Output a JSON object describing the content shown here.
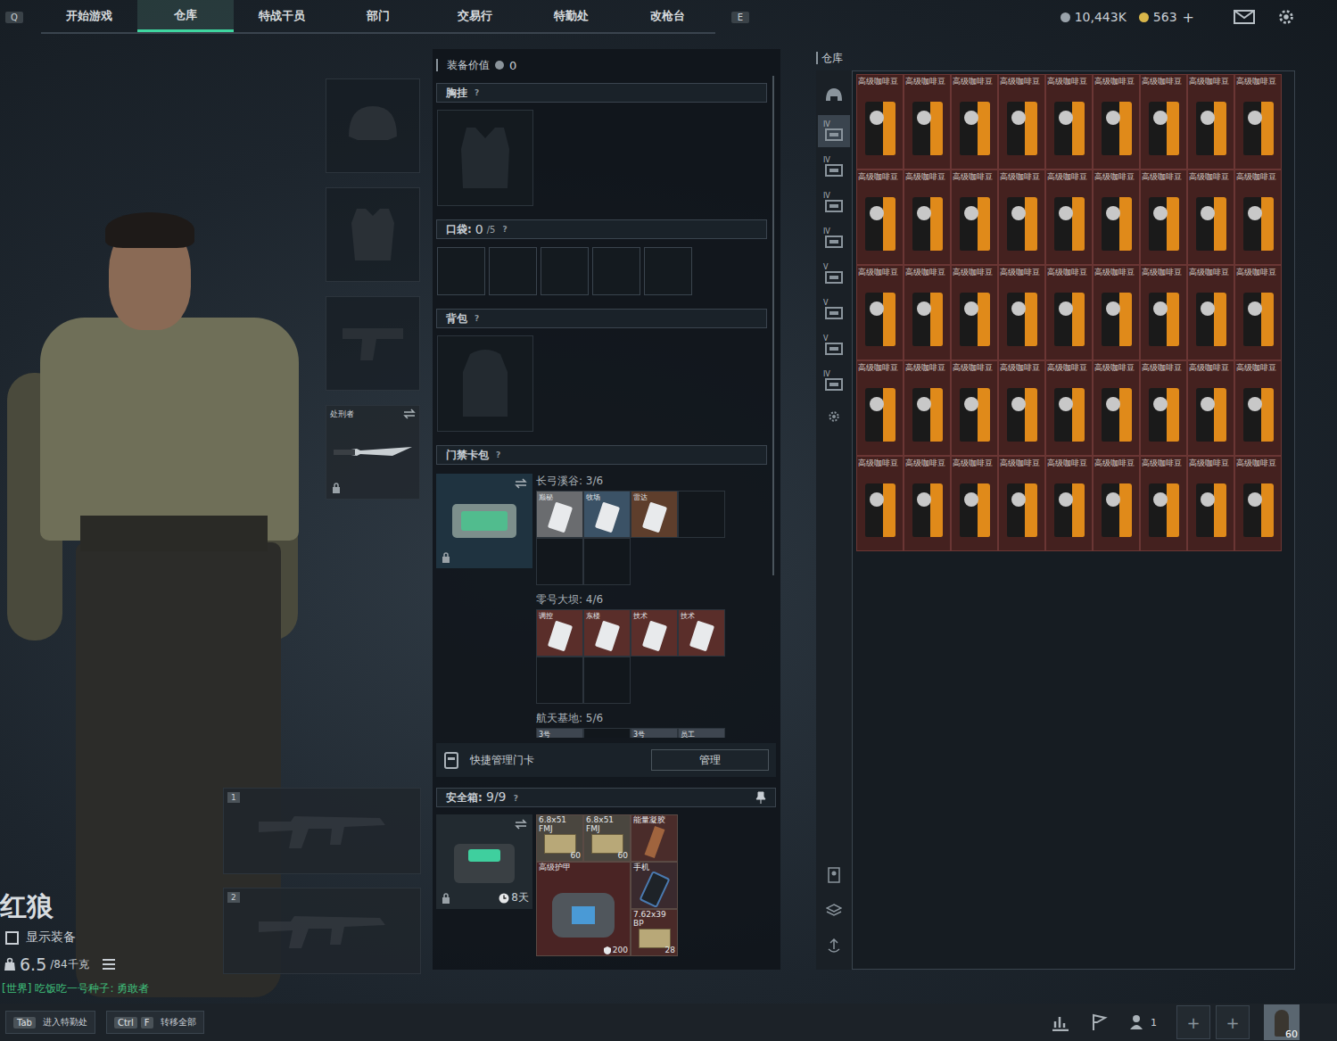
{
  "nav": {
    "left_key": "Q",
    "tabs": [
      {
        "label": "开始游戏",
        "selected": false
      },
      {
        "label": "仓库",
        "selected": true
      },
      {
        "label": "特战干员",
        "selected": false
      },
      {
        "label": "部门",
        "selected": false
      },
      {
        "label": "交易行",
        "selected": false
      },
      {
        "label": "特勤处",
        "selected": false
      },
      {
        "label": "改枪台",
        "selected": false
      }
    ],
    "right_key": "E",
    "currencies": [
      {
        "value": "10,443K",
        "color": "#9aa3ab"
      },
      {
        "value": "563",
        "color": "#d9b64a"
      }
    ],
    "add": "+"
  },
  "character": {
    "name": "红狼",
    "show_equipment": {
      "label": "显示装备",
      "checked": false
    },
    "weight": "6.5",
    "weight_max": "/84千克"
  },
  "chat": {
    "channel": "[世界]",
    "text": "吃饭吃一号种子: 勇敢者"
  },
  "gear_slots": [
    {
      "kind": "helmet",
      "filled": false
    },
    {
      "kind": "armor",
      "filled": false
    },
    {
      "kind": "pistol",
      "filled": false
    },
    {
      "kind": "melee",
      "filled": true,
      "label": "处刑者",
      "locked": true
    }
  ],
  "weapon_slots": [
    {
      "number": "1",
      "filled": false
    },
    {
      "number": "2",
      "filled": false
    }
  ],
  "loadout": {
    "value_label": "装备价值",
    "value": "0",
    "chest_rig": {
      "label": "胸挂",
      "help": "?"
    },
    "pockets": {
      "label": "口袋:",
      "count": "0",
      "capacity": "/5",
      "help": "?",
      "slots": [
        {
          "filled": false
        },
        {
          "filled": false
        },
        {
          "filled": false
        },
        {
          "filled": false
        },
        {
          "filled": false
        }
      ]
    },
    "backpack": {
      "label": "背包",
      "help": "?"
    },
    "keycard_case": {
      "label": "门禁卡包",
      "help": "?",
      "locked": true,
      "regions": [
        {
          "name": "长弓溪谷: 3/6",
          "cards": [
            {
              "filled": true,
              "label": "巅秘",
              "color": "#6a6c6f"
            },
            {
              "filled": true,
              "label": "牧场",
              "color": "#3b5266"
            },
            {
              "filled": true,
              "label": "雷达",
              "color": "#5e3e2c"
            },
            {
              "filled": false
            },
            {
              "filled": false
            },
            {
              "filled": false
            }
          ]
        },
        {
          "name": "零号大坝: 4/6",
          "cards": [
            {
              "filled": true,
              "label": "调控",
              "color": "#5a2e2a"
            },
            {
              "filled": true,
              "label": "东楼",
              "color": "#5a2e2a"
            },
            {
              "filled": true,
              "label": "技术",
              "color": "#5a2e2a"
            },
            {
              "filled": true,
              "label": "技术",
              "color": "#5a2e2a"
            },
            {
              "filled": false
            },
            {
              "filled": false
            }
          ]
        },
        {
          "name": "航天基地: 5/6",
          "cards": [
            {
              "filled": true,
              "label": "3号",
              "color": "#3e4650"
            },
            {
              "filled": false
            },
            {
              "filled": true,
              "label": "3号",
              "color": "#3e4650"
            },
            {
              "filled": true,
              "label": "员工",
              "color": "#3e4650"
            }
          ]
        }
      ]
    },
    "quick_manage": {
      "label": "快捷管理门卡",
      "button": "管理"
    },
    "safe_box": {
      "label": "安全箱:",
      "count": "9/9",
      "help": "?",
      "timer": "8天",
      "locked": true,
      "items": [
        {
          "kind": "ammo",
          "label": "6.8x51 FMJ",
          "count": "60",
          "color": "#4a463f"
        },
        {
          "kind": "ammo",
          "label": "6.8x51 FMJ",
          "count": "60",
          "color": "#4a463f"
        },
        {
          "kind": "gel",
          "label": "能量凝胶",
          "color": "#4a2c2a"
        },
        {
          "kind": "armor",
          "label": "高级护甲",
          "count": "200",
          "color": "#4a2424"
        },
        {
          "kind": "phone",
          "label": "手机",
          "color": "#3a2a2e"
        },
        {
          "kind": "ammo",
          "label": "7.62x39 BP",
          "count": "28",
          "color": "#4a2a28"
        }
      ]
    }
  },
  "warehouse": {
    "title": "仓库",
    "tabs": [
      {
        "kind": "all",
        "selected": false
      },
      {
        "kind": "tab",
        "label": "IV",
        "selected": true
      },
      {
        "kind": "tab",
        "label": "IV",
        "selected": false
      },
      {
        "kind": "tab",
        "label": "IV",
        "selected": false
      },
      {
        "kind": "tab",
        "label": "IV",
        "selected": false
      },
      {
        "kind": "tab",
        "label": "V",
        "selected": false
      },
      {
        "kind": "tab",
        "label": "V",
        "selected": false
      },
      {
        "kind": "tab",
        "label": "V",
        "selected": false
      },
      {
        "kind": "tab",
        "label": "IV",
        "selected": false
      }
    ],
    "items": [
      "高级咖啡豆",
      "高级咖啡豆",
      "高级咖啡豆",
      "高级咖啡豆",
      "高级咖啡豆",
      "高级咖啡豆",
      "高级咖啡豆",
      "高级咖啡豆",
      "高级咖啡豆",
      "高级咖啡豆",
      "高级咖啡豆",
      "高级咖啡豆",
      "高级咖啡豆",
      "高级咖啡豆",
      "高级咖啡豆",
      "高级咖啡豆",
      "高级咖啡豆",
      "高级咖啡豆",
      "高级咖啡豆",
      "高级咖啡豆",
      "高级咖啡豆",
      "高级咖啡豆",
      "高级咖啡豆",
      "高级咖啡豆",
      "高级咖啡豆",
      "高级咖啡豆",
      "高级咖啡豆",
      "高级咖啡豆",
      "高级咖啡豆",
      "高级咖啡豆",
      "高级咖啡豆",
      "高级咖啡豆",
      "高级咖啡豆",
      "高级咖啡豆",
      "高级咖啡豆",
      "高级咖啡豆",
      "高级咖啡豆",
      "高级咖啡豆",
      "高级咖啡豆",
      "高级咖啡豆",
      "高级咖啡豆",
      "高级咖啡豆",
      "高级咖啡豆",
      "高级咖啡豆",
      "高级咖啡豆"
    ]
  },
  "bottom_bar": {
    "hints": [
      {
        "keys": [
          "Tab"
        ],
        "label": "进入特勤处"
      },
      {
        "keys": [
          "Ctrl",
          "F"
        ],
        "label": "转移全部"
      }
    ],
    "friends": "1",
    "party_slots": [
      "+",
      "+"
    ],
    "level": "60"
  }
}
